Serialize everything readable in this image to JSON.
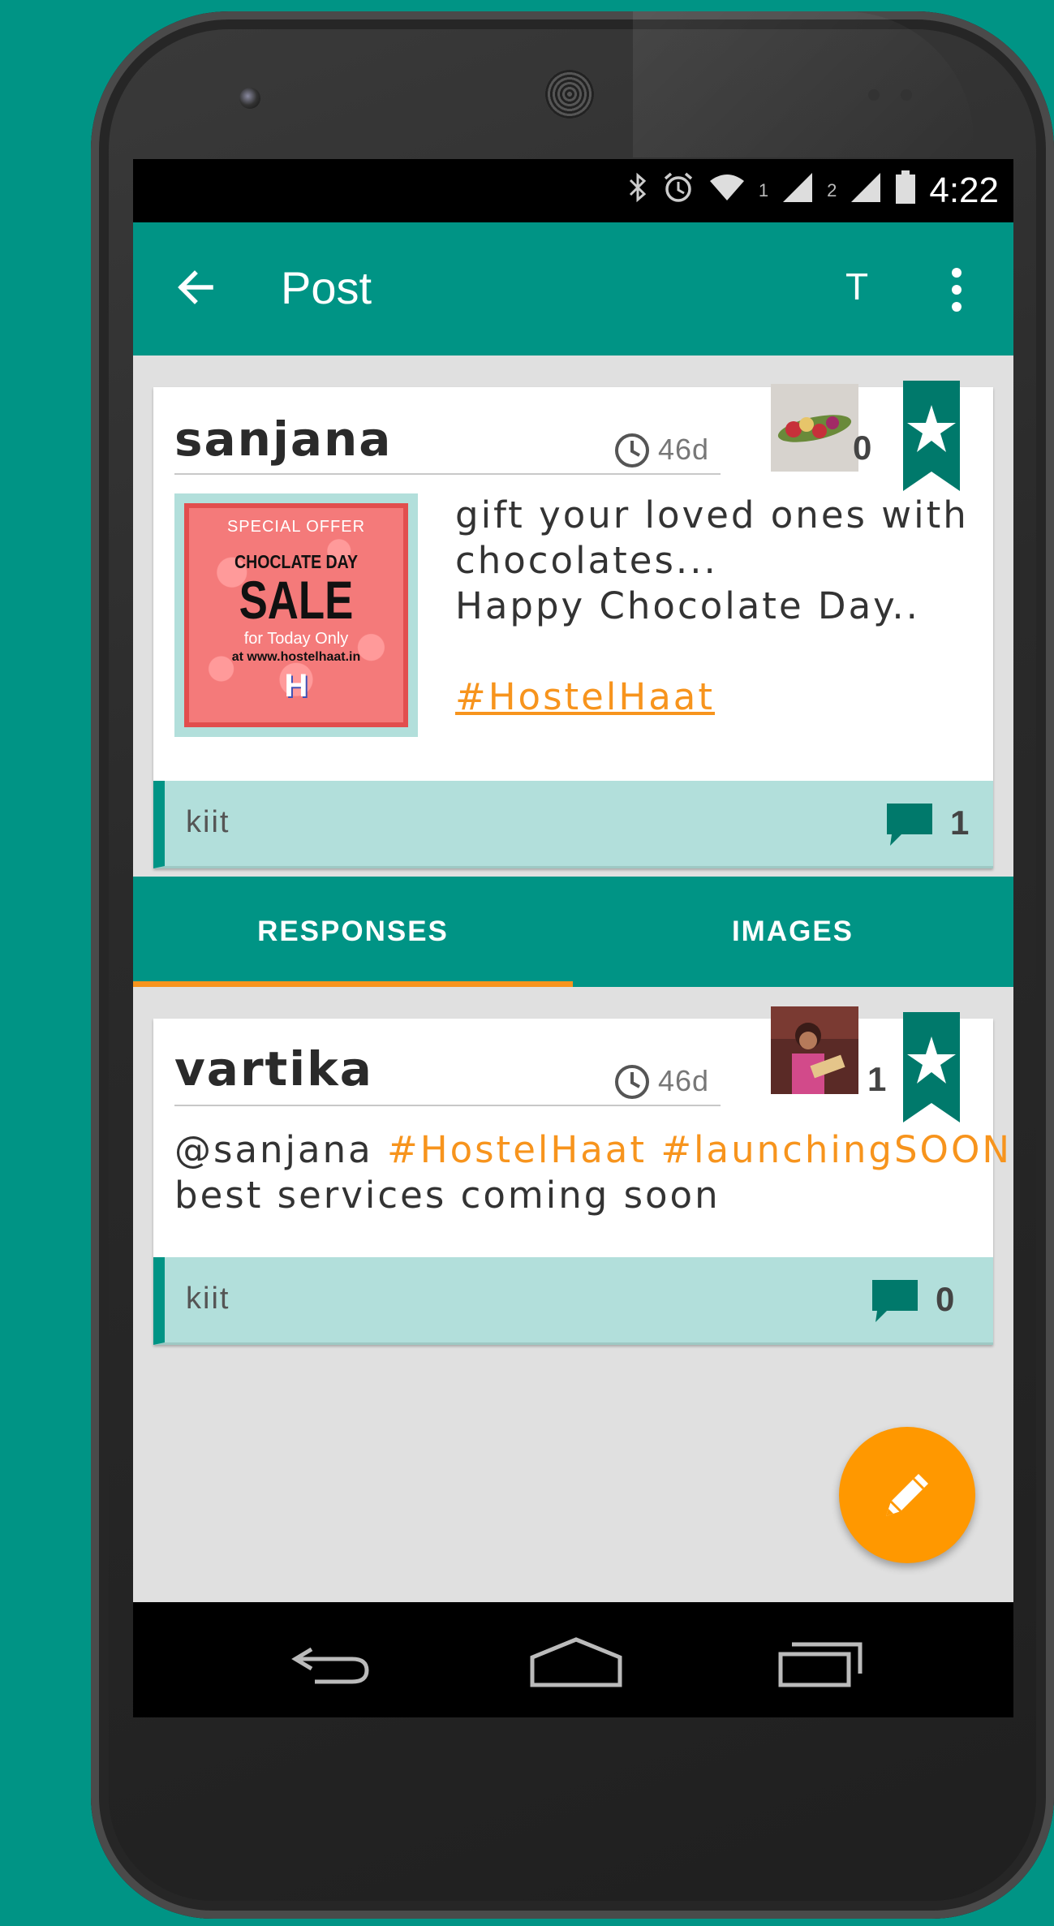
{
  "colors": {
    "teal": "#009485",
    "teal_light": "#b2dfdb",
    "accent": "#f7941d",
    "fab": "#ff9800"
  },
  "status_bar": {
    "time": "4:22",
    "sim1": "1",
    "sim2": "2",
    "icons": [
      "bluetooth-icon",
      "alarm-icon",
      "wifi-icon",
      "signal-icon",
      "signal-icon",
      "battery-icon"
    ]
  },
  "app_bar": {
    "title": "Post",
    "action_text": "T",
    "back_icon": "arrow-back-icon",
    "menu_icon": "more-vert-icon"
  },
  "post": {
    "author": "sanjana",
    "time": "46d",
    "likes": "0",
    "image_text": {
      "line1": "SPECIAL OFFER",
      "line2": "CHOCLATE DAY",
      "line3": "SALE",
      "line4": "for Today Only",
      "line5": "at www.hostelhaat.in",
      "logo": "H"
    },
    "text_lines": [
      "gift your loved ones with",
      "chocolates...",
      "Happy Chocolate Day.."
    ],
    "hashtag": "#HostelHaat",
    "tag": "kiit",
    "comments": "1"
  },
  "tabs": [
    {
      "label": "RESPONSES",
      "active": true
    },
    {
      "label": "IMAGES",
      "active": false
    }
  ],
  "response": {
    "author": "vartika",
    "time": "46d",
    "likes": "1",
    "mention": "@sanjana",
    "hashtags": "#HostelHaat #launchingSOON",
    "line2": "best services coming soon",
    "tag": "kiit",
    "comments": "0"
  },
  "fab_icon": "pencil-icon",
  "nav_bar": {
    "icons": [
      "back-nav-icon",
      "home-nav-icon",
      "recents-nav-icon"
    ]
  }
}
